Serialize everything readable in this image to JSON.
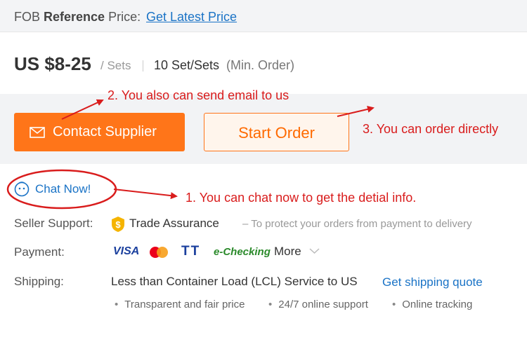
{
  "fob": {
    "prefix": "FOB ",
    "bold": "Reference",
    "suffix": " Price:",
    "link": "Get Latest Price"
  },
  "price": {
    "range": "US $8-25",
    "unit": "/ Sets",
    "moq_value": "10 Set/Sets",
    "moq_label": "(Min. Order)"
  },
  "actions": {
    "contact_label": "Contact Supplier",
    "start_order_label": "Start Order",
    "chat_label": "Chat Now!"
  },
  "annotations": {
    "email": "2. You also can send email to us",
    "order": "3. You can order directly",
    "chat": "1. You can chat now to get the detial info."
  },
  "seller_support": {
    "label": "Seller Support:",
    "title": "Trade Assurance",
    "description": "– To protect your orders from payment to delivery"
  },
  "payment": {
    "label": "Payment:",
    "methods": [
      "VISA",
      "TT",
      "e-Checking"
    ],
    "more": "More"
  },
  "shipping": {
    "label": "Shipping:",
    "service": "Less than Container Load (LCL) Service to US",
    "quote_link": "Get shipping quote",
    "features": [
      "Transparent and fair price",
      "24/7 online support",
      "Online tracking"
    ]
  },
  "colors": {
    "accent": "#ff7519",
    "link": "#1a73c6",
    "annotation": "#d91c1c"
  },
  "icons": [
    "mail-icon",
    "chat-face-icon",
    "trade-assurance-icon",
    "mastercard-icon",
    "chevron-down-icon"
  ]
}
